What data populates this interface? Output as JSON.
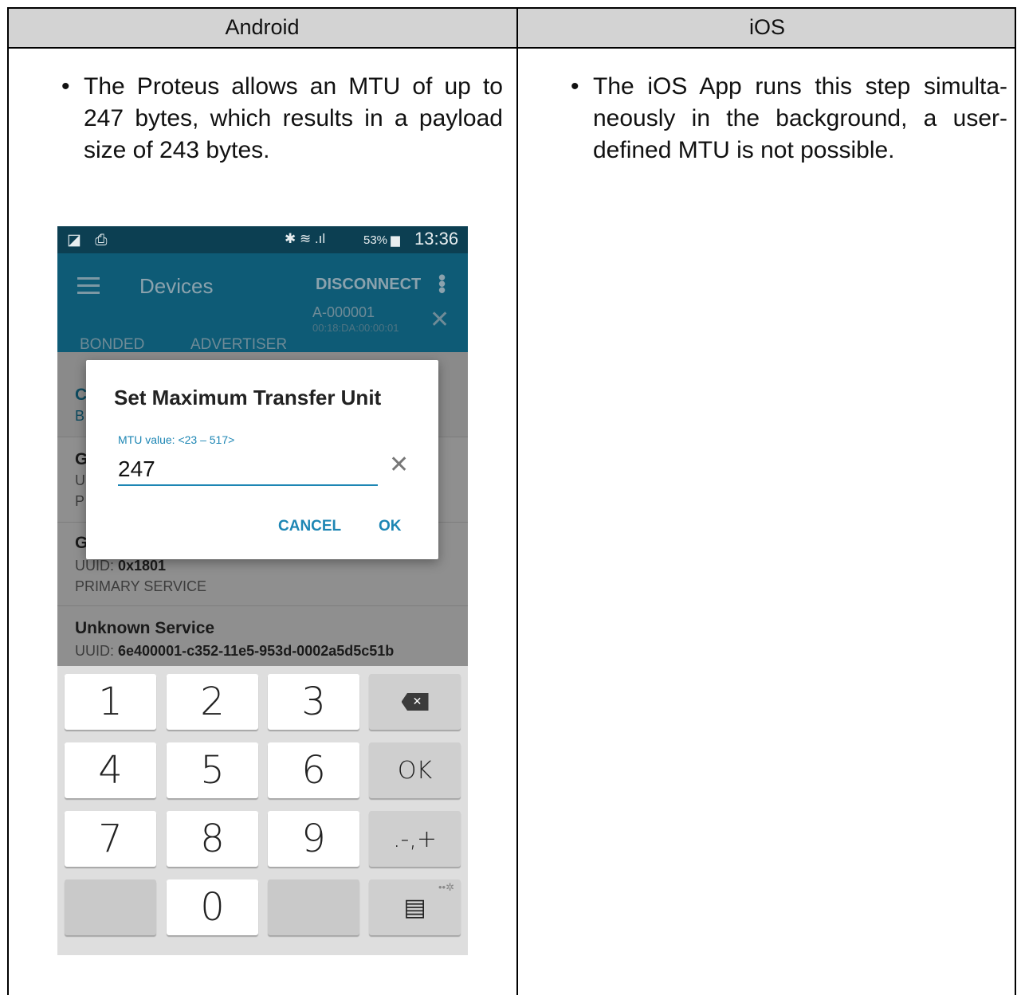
{
  "table": {
    "headers": [
      "Android",
      "iOS"
    ],
    "android_text": "The Proteus allows an MTU of up to 247 bytes, which results in a payload size of 243 bytes.",
    "ios_text": "The iOS App runs this step simulta-neously in the background, a user-defined MTU is not possible.",
    "bullet": "•"
  },
  "phone": {
    "statusbar": {
      "left_icons": "◪ ⎙",
      "signal_icons": "✱ ≋ .ıl",
      "battery": "53% ▆",
      "time": "13:36"
    },
    "appbar": {
      "title": "Devices",
      "disconnect": "DISCONNECT",
      "kebab": "⋮"
    },
    "tabs": {
      "bonded": "BONDED",
      "advertiser": "ADVERTISER",
      "device_name": "A-000001",
      "device_address": "00:18:DA:00:00:01",
      "close": "✕"
    },
    "list": [
      {
        "title": "C",
        "uuid_label": "",
        "uuid": "",
        "type": "B"
      },
      {
        "title": "G",
        "uuid_label": "U",
        "uuid": "",
        "type": "P"
      },
      {
        "title": "G",
        "uuid_label": "UUID: ",
        "uuid": "0x1801",
        "type": "PRIMARY SERVICE"
      },
      {
        "title": "Unknown Service",
        "uuid_label": "UUID: ",
        "uuid": "6e400001-c352-11e5-953d-0002a5d5c51b",
        "type": "PRIMARY SERVICE"
      }
    ],
    "dialog": {
      "title": "Set Maximum Transfer Unit",
      "label": "MTU value: <23 – 517>",
      "value": "247",
      "clear": "✕",
      "cancel": "CANCEL",
      "ok": "OK"
    },
    "keyboard": {
      "keys": [
        "1",
        "2",
        "3",
        "4",
        "5",
        "6",
        "7",
        "8",
        "9",
        "0"
      ],
      "backspace": "✕",
      "ok": "OK",
      "symbols": ".-,+",
      "clipboard": "▤",
      "settings": "••✲"
    },
    "colors": {
      "statusbar": "#0c3f52",
      "appbar": "#0e5b76",
      "accent": "#1d86b4"
    }
  }
}
